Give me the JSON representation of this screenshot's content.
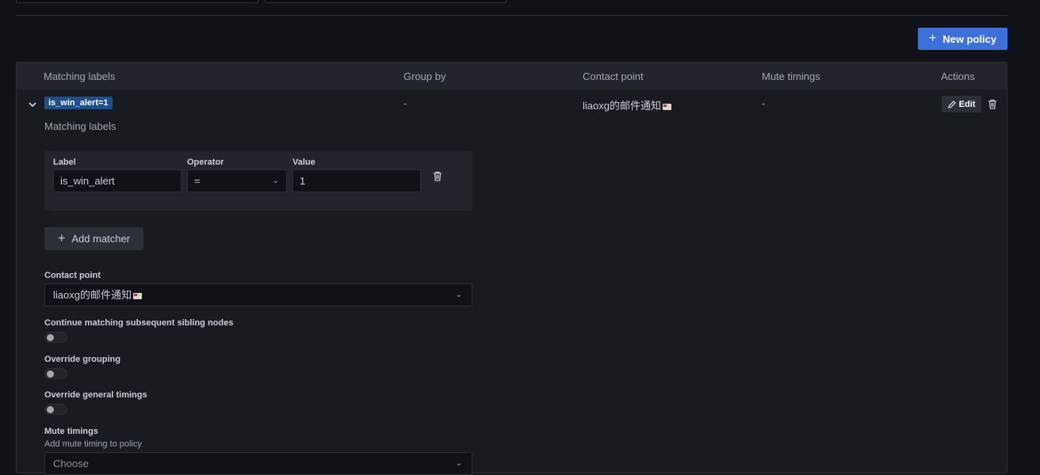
{
  "toolbar": {
    "new_policy_label": "New policy"
  },
  "table": {
    "headers": [
      "Matching labels",
      "Group by",
      "Contact point",
      "Mute timings",
      "Actions"
    ],
    "row": {
      "label_chip": "is_win_alert=1",
      "group_by": "-",
      "contact_point": "liaoxg的邮件通知",
      "mute_timings": "-",
      "edit_label": "Edit"
    }
  },
  "editor": {
    "matching_labels_title": "Matching labels",
    "matcher": {
      "label_header": "Label",
      "operator_header": "Operator",
      "value_header": "Value",
      "label_value": "is_win_alert",
      "operator_value": "=",
      "value_value": "1"
    },
    "add_matcher_label": "Add matcher",
    "contact_point": {
      "label": "Contact point",
      "value": "liaoxg的邮件通知"
    },
    "continue_matching": {
      "label": "Continue matching subsequent sibling nodes",
      "on": false
    },
    "override_grouping": {
      "label": "Override grouping",
      "on": false
    },
    "override_timings": {
      "label": "Override general timings",
      "on": false
    },
    "mute_timings": {
      "label": "Mute timings",
      "description": "Add mute timing to policy",
      "placeholder": "Choose"
    }
  },
  "colors": {
    "primary": "#3d71d9",
    "chip": "#1f4f8a",
    "background": "#111217",
    "panel": "#181b1f"
  }
}
